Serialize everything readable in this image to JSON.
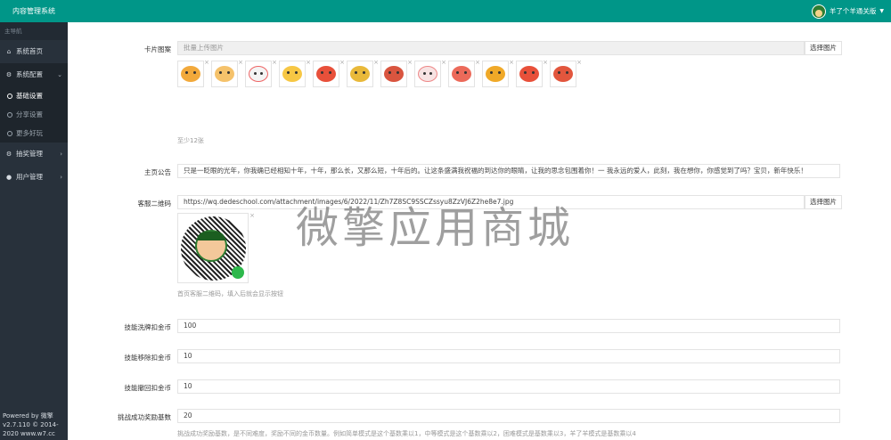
{
  "header": {
    "brand": "内容管理系统",
    "user_name": "羊了个羊通关版",
    "accent": "#009688"
  },
  "sidebar": {
    "heading": "主导航",
    "items": [
      {
        "label": "系统首页",
        "icon": "home-icon"
      },
      {
        "label": "系统配置",
        "icon": "gear-icon"
      },
      {
        "label": "抽奖管理",
        "icon": "gear-icon"
      },
      {
        "label": "用户管理",
        "icon": "user-icon"
      }
    ],
    "subitems": [
      {
        "label": "基础设置"
      },
      {
        "label": "分享设置"
      },
      {
        "label": "更多好玩"
      }
    ],
    "footer_line1": "Powered by 微擎",
    "footer_line2": "v2.7.110 © 2014-",
    "footer_line3": "2020 www.w7.cc"
  },
  "form": {
    "card_label": "卡片图案",
    "card_placeholder": "批量上传图片",
    "choose_image": "选择图片",
    "card_icons": [
      "dog-icon",
      "monkey-icon",
      "rooster-icon",
      "tiger-icon",
      "ox-icon",
      "dragon-icon",
      "monkey-icon",
      "rabbit-icon",
      "pig-icon",
      "tiger-icon",
      "ox-icon",
      "lion-icon"
    ],
    "card_help": "至少12张",
    "notice_label": "主页公告",
    "notice_value": "只是一眨眼的光年，你我确已经相知十年，十年，那么长，又那么短，十年后的。让这条盛满我祝福的到达你的眼睛，让我的思念包围着你！一 我永远的爱人，此刻，我在想你，你感觉到了吗？宝贝，新年快乐！",
    "qr_label": "客服二维码",
    "qr_value": "https://wq.dedeschool.com/attachment/images/6/2022/11/Zh7Z8SC9SSCZssyu8ZzVJ6Z2he8e7.jpg",
    "qr_help": "首页客服二维码，填入后就会显示按钮",
    "shuffle_label": "技能洗牌扣金币",
    "shuffle_value": "100",
    "remove_label": "技能移除扣金币",
    "remove_value": "10",
    "undo_label": "技能撤回扣金币",
    "undo_value": "10",
    "reward_label": "挑战成功奖励基数",
    "reward_value": "20",
    "reward_help": "挑战成功奖励基数，是不同难度，奖励不同的金币数量。例如简单模式是这个基数乘以1，中等模式是这个基数乘以2，困难模式是基数乘以3，羊了羊模式是基数乘以4"
  },
  "watermark": "微擎应用商城"
}
